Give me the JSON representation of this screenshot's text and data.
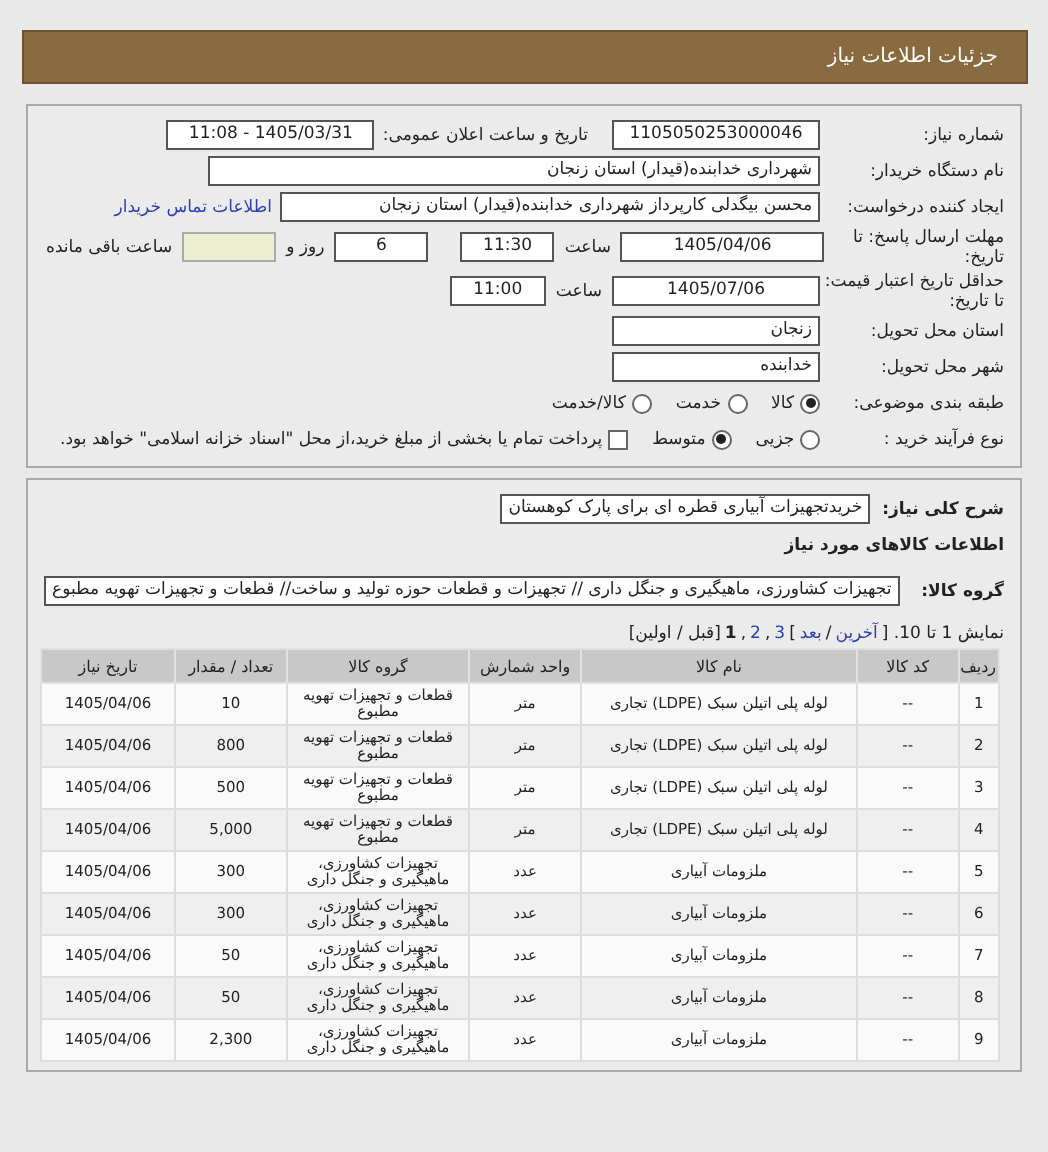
{
  "header": {
    "title": "جزئیات اطلاعات نیاز"
  },
  "form": {
    "need_number": {
      "label": "شماره نیاز:",
      "value": "1105050253000046"
    },
    "announce": {
      "label": "تاریخ و ساعت اعلان عمومی:",
      "value": "1405/03/31 - 11:08"
    },
    "buyer": {
      "label": "نام دستگاه خریدار:",
      "value": "شهرداری خدابنده(قیدار) استان زنجان"
    },
    "creator": {
      "label": "ایجاد کننده درخواست:",
      "value": "محسن بیگدلی کارپرداز شهرداری خدابنده(قیدار) استان زنجان",
      "link": "اطلاعات تماس خریدار"
    },
    "deadline": {
      "label": "مهلت ارسال پاسخ: تا تاریخ:",
      "date": "1405/04/06",
      "time_label": "ساعت",
      "time": "11:30",
      "days": "6",
      "days_label": "روز و",
      "remaining_label": "ساعت باقی مانده"
    },
    "validity": {
      "label": "حداقل تاریخ اعتبار قیمت: تا تاریخ:",
      "date": "1405/07/06",
      "time_label": "ساعت",
      "time": "11:00"
    },
    "province": {
      "label": "استان محل تحویل:",
      "value": "زنجان"
    },
    "city": {
      "label": "شهر محل تحویل:",
      "value": "خدابنده"
    },
    "category": {
      "label": "طبقه بندی موضوعی:",
      "options": [
        {
          "label": "کالا",
          "selected": true
        },
        {
          "label": "خدمت",
          "selected": false
        },
        {
          "label": "کالا/خدمت",
          "selected": false
        }
      ]
    },
    "process": {
      "label": "نوع فرآیند خرید :",
      "options": [
        {
          "label": "جزیی",
          "selected": false
        },
        {
          "label": "متوسط",
          "selected": true
        }
      ],
      "treasury": {
        "label": "پرداخت تمام یا بخشی از مبلغ خرید،از محل \"اسناد خزانه اسلامی\" خواهد بود.",
        "checked": false
      }
    }
  },
  "summary": {
    "label": "شرح کلی نیاز:",
    "value": "خریدتجهیزات آبیاری قطره ای برای پارک کوهستان"
  },
  "goods_heading": "اطلاعات کالاهای مورد نیاز",
  "goods_group": {
    "label": "گروه کالا:",
    "value": "تجهیزات کشاورزی، ماهیگیری و جنگل داری // تجهیزات و قطعات حوزه تولید و ساخت// قطعات و تجهیزات تهویه مطبوع"
  },
  "pagination": [
    {
      "kind": "text",
      "text": "نمایش 1 تا 10. ["
    },
    {
      "kind": "link",
      "text": "آخرین"
    },
    {
      "kind": "text",
      "text": "/"
    },
    {
      "kind": "link",
      "text": "بعد"
    },
    {
      "kind": "text",
      "text": "]"
    },
    {
      "kind": "link",
      "text": "3"
    },
    {
      "kind": "text",
      "text": ","
    },
    {
      "kind": "link",
      "text": "2"
    },
    {
      "kind": "text",
      "text": ","
    },
    {
      "kind": "current",
      "text": "1"
    },
    {
      "kind": "text",
      "text": "[قبل / اولین]"
    }
  ],
  "table": {
    "columns": [
      "ردیف",
      "کد کالا",
      "نام کالا",
      "واحد شمارش",
      "گروه کالا",
      "تعداد / مقدار",
      "تاریخ نیاز"
    ],
    "rows": [
      [
        "1",
        "--",
        "لوله پلی اتیلن سبک (LDPE) تجاری",
        "متر",
        "قطعات و تجهیزات تهویه مطبوع",
        "10",
        "1405/04/06"
      ],
      [
        "2",
        "--",
        "لوله پلی اتیلن سبک (LDPE) تجاری",
        "متر",
        "قطعات و تجهیزات تهویه مطبوع",
        "800",
        "1405/04/06"
      ],
      [
        "3",
        "--",
        "لوله پلی اتیلن سبک (LDPE) تجاری",
        "متر",
        "قطعات و تجهیزات تهویه مطبوع",
        "500",
        "1405/04/06"
      ],
      [
        "4",
        "--",
        "لوله پلی اتیلن سبک (LDPE) تجاری",
        "متر",
        "قطعات و تجهیزات تهویه مطبوع",
        "5,000",
        "1405/04/06"
      ],
      [
        "5",
        "--",
        "ملزومات آبیاری",
        "عدد",
        "تجهیزات کشاورزی، ماهیگیری و جنگل داری",
        "300",
        "1405/04/06"
      ],
      [
        "6",
        "--",
        "ملزومات آبیاری",
        "عدد",
        "تجهیزات کشاورزی، ماهیگیری و جنگل داری",
        "300",
        "1405/04/06"
      ],
      [
        "7",
        "--",
        "ملزومات آبیاری",
        "عدد",
        "تجهیزات کشاورزی، ماهیگیری و جنگل داری",
        "50",
        "1405/04/06"
      ],
      [
        "8",
        "--",
        "ملزومات آبیاری",
        "عدد",
        "تجهیزات کشاورزی، ماهیگیری و جنگل داری",
        "50",
        "1405/04/06"
      ],
      [
        "9",
        "--",
        "ملزومات آبیاری",
        "عدد",
        "تجهیزات کشاورزی، ماهیگیری و جنگل داری",
        "2,300",
        "1405/04/06"
      ]
    ]
  }
}
